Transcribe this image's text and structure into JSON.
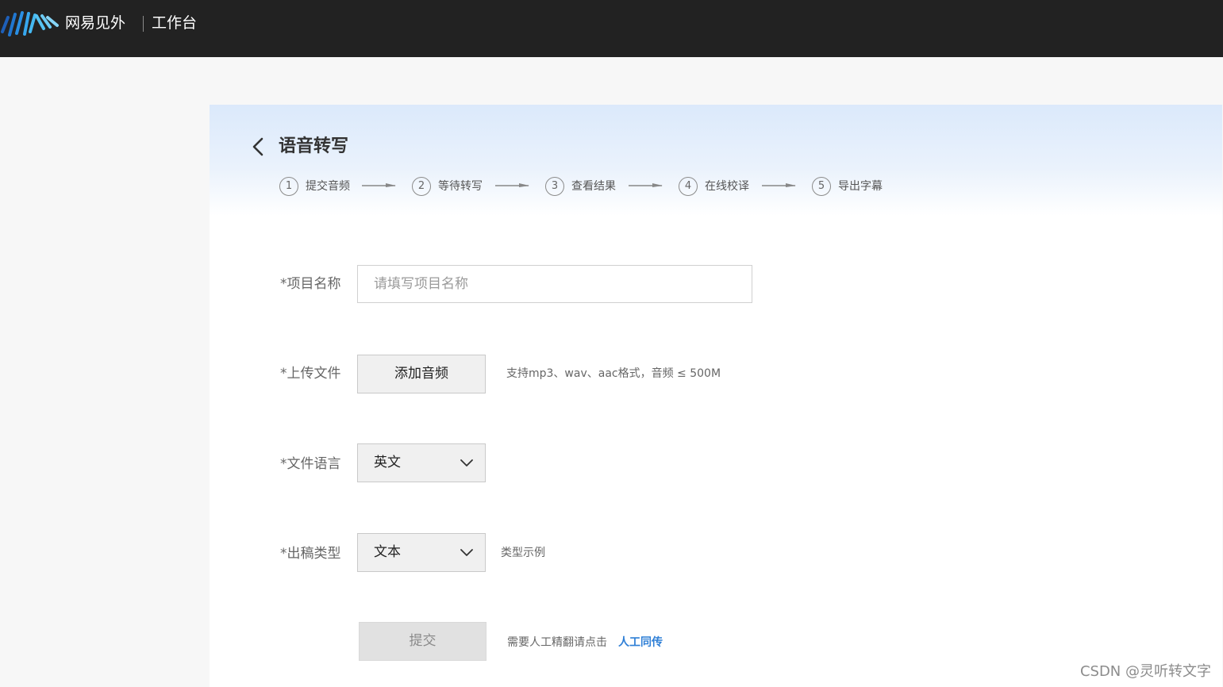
{
  "header": {
    "brand": "网易见外",
    "workbench": "工作台"
  },
  "page": {
    "title": "语音转写",
    "back_icon": "chevron-left-icon"
  },
  "steps": [
    {
      "num": "1",
      "label": "提交音频"
    },
    {
      "num": "2",
      "label": "等待转写"
    },
    {
      "num": "3",
      "label": "查看结果"
    },
    {
      "num": "4",
      "label": "在线校译"
    },
    {
      "num": "5",
      "label": "导出字幕"
    }
  ],
  "form": {
    "project_name": {
      "label": "*项目名称",
      "placeholder": "请填写项目名称",
      "value": ""
    },
    "upload": {
      "label": "*上传文件",
      "button": "添加音频",
      "hint": "支持mp3、wav、aac格式，音频 ≤ 500M"
    },
    "language": {
      "label": "*文件语言",
      "value": "英文"
    },
    "output_type": {
      "label": "*出稿类型",
      "value": "文本",
      "example_link": "类型示例"
    },
    "submit": {
      "button": "提交",
      "hint": "需要人工精翻请点击",
      "link": "人工同传"
    }
  },
  "watermark": "CSDN @灵听转文字",
  "colors": {
    "topbar": "#222222",
    "link": "#2f7fd6",
    "header_gradient": "#dbe9fb"
  }
}
